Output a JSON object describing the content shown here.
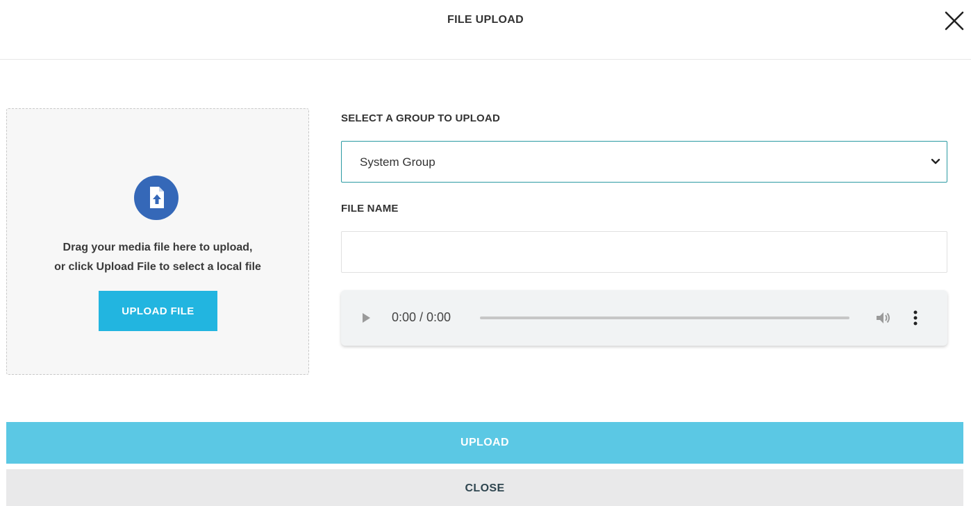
{
  "dialog": {
    "title": "FILE UPLOAD",
    "close_icon": "close-icon"
  },
  "dropzone": {
    "icon": "file-upload-icon",
    "text_line1": "Drag your media file here to upload,",
    "text_line2": "or click Upload File to select a local file",
    "upload_file_label": "UPLOAD FILE"
  },
  "form": {
    "group_label": "SELECT A GROUP TO UPLOAD",
    "group_selected": "System Group",
    "file_name_label": "FILE NAME",
    "file_name_value": ""
  },
  "audio_player": {
    "time": "0:00 / 0:00",
    "progress": 0
  },
  "actions": {
    "upload_label": "UPLOAD",
    "close_label": "CLOSE"
  },
  "colors": {
    "accent_blue": "#22b5e0",
    "upload_button": "#5bc8e4",
    "icon_circle": "#3568b8",
    "select_border": "#2a9aa2",
    "close_button_bg": "#e9e9ea"
  }
}
